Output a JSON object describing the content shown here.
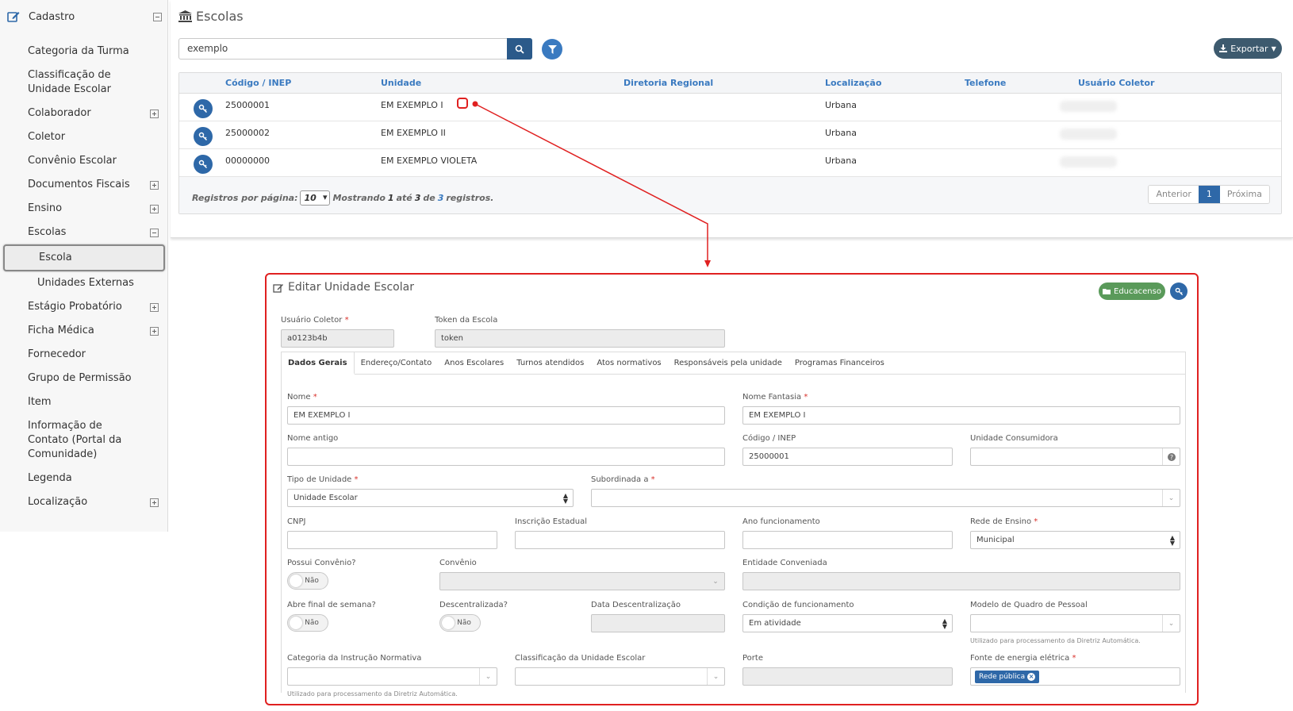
{
  "sidebar": {
    "header": "Cadastro",
    "items": [
      {
        "label": "Categoria da Turma"
      },
      {
        "label": "Classificação de Unidade Escolar"
      },
      {
        "label": "Colaborador"
      },
      {
        "label": "Coletor"
      },
      {
        "label": "Convênio Escolar"
      },
      {
        "label": "Documentos Fiscais"
      },
      {
        "label": "Ensino"
      },
      {
        "label": "Escolas"
      },
      {
        "label": "Escola"
      },
      {
        "label": "Unidades Externas"
      },
      {
        "label": "Estágio Probatório"
      },
      {
        "label": "Ficha Médica"
      },
      {
        "label": "Fornecedor"
      },
      {
        "label": "Grupo de Permissão"
      },
      {
        "label": "Item"
      },
      {
        "label": "Informação de Contato (Portal da Comunidade)"
      },
      {
        "label": "Legenda"
      },
      {
        "label": "Localização"
      }
    ]
  },
  "list": {
    "title": "Escolas",
    "search_value": "exemplo",
    "export_label": "Exportar",
    "columns": [
      "Código / INEP",
      "Unidade",
      "Diretoria Regional",
      "Localização",
      "Telefone",
      "Usuário Coletor"
    ],
    "rows": [
      {
        "code": "25000001",
        "unit": "EM EXEMPLO I",
        "dir": "",
        "loc": "Urbana",
        "phone": ""
      },
      {
        "code": "25000002",
        "unit": "EM EXEMPLO II",
        "dir": "",
        "loc": "Urbana",
        "phone": ""
      },
      {
        "code": "00000000",
        "unit": "EM EXEMPLO VIOLETA",
        "dir": "",
        "loc": "Urbana",
        "phone": ""
      }
    ],
    "footer": {
      "per_page_label": "Registros por página:",
      "per_page_value": "10",
      "showing": "Mostrando",
      "from": "1",
      "until": "até",
      "to": "3",
      "of": "de",
      "total": "3",
      "records": "registros."
    },
    "pager": {
      "prev": "Anterior",
      "current": "1",
      "next": "Próxima"
    }
  },
  "edit": {
    "title": "Editar Unidade Escolar",
    "educacenso_label": "Educacenso",
    "usuario_coletor": {
      "label": "Usuário Coletor",
      "value": "a0123b4b"
    },
    "token": {
      "label": "Token da Escola",
      "value": "token"
    },
    "tabs": [
      "Dados Gerais",
      "Endereço/Contato",
      "Anos Escolares",
      "Turnos atendidos",
      "Atos normativos",
      "Responsáveis pela unidade",
      "Programas Financeiros"
    ],
    "fields": {
      "nome": {
        "label": "Nome",
        "value": "EM EXEMPLO I"
      },
      "nome_fantasia": {
        "label": "Nome Fantasia",
        "value": "EM EXEMPLO I"
      },
      "nome_antigo": {
        "label": "Nome antigo",
        "value": ""
      },
      "codigo_inep": {
        "label": "Código / INEP",
        "value": "25000001"
      },
      "unidade_consumidora": {
        "label": "Unidade Consumidora",
        "value": ""
      },
      "tipo_unidade": {
        "label": "Tipo de Unidade",
        "value": "Unidade Escolar"
      },
      "subordinada": {
        "label": "Subordinada a",
        "value": ""
      },
      "cnpj": {
        "label": "CNPJ",
        "value": ""
      },
      "inscricao": {
        "label": "Inscrição Estadual",
        "value": ""
      },
      "ano_func": {
        "label": "Ano funcionamento",
        "value": ""
      },
      "rede_ensino": {
        "label": "Rede de Ensino",
        "value": "Municipal"
      },
      "possui_convenio": {
        "label": "Possui Convênio?",
        "value": "Não"
      },
      "convenio": {
        "label": "Convênio",
        "value": ""
      },
      "entidade": {
        "label": "Entidade Conveniada",
        "value": ""
      },
      "abre_fds": {
        "label": "Abre final de semana?",
        "value": "Não"
      },
      "descentralizada": {
        "label": "Descentralizada?",
        "value": "Não"
      },
      "data_desc": {
        "label": "Data Descentralização",
        "value": ""
      },
      "condicao": {
        "label": "Condição de funcionamento",
        "value": "Em atividade"
      },
      "modelo_quadro": {
        "label": "Modelo de Quadro de Pessoal",
        "value": "",
        "hint": "Utilizado para processamento da Diretriz Automática."
      },
      "categoria_in": {
        "label": "Categoria da Instrução Normativa",
        "value": "",
        "hint": "Utilizado para processamento da Diretriz Automática."
      },
      "classificacao_ue": {
        "label": "Classificação da Unidade Escolar",
        "value": ""
      },
      "porte": {
        "label": "Porte",
        "value": ""
      },
      "fonte_energia": {
        "label": "Fonte de energia elétrica",
        "value": "Rede pública"
      }
    }
  },
  "colors": {
    "primary": "#2e68a8",
    "annotation": "#e02020",
    "success": "#5a9a5a"
  }
}
